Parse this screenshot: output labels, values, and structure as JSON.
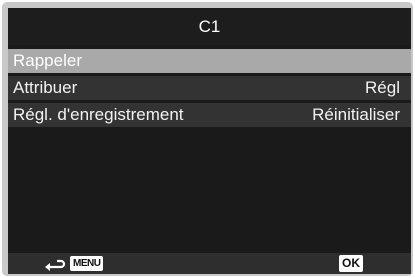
{
  "header": {
    "title": "C1"
  },
  "menu": {
    "items": [
      {
        "label": "Rappeler",
        "value": ""
      },
      {
        "label": "Attribuer",
        "value": "Régl"
      },
      {
        "label": "Régl. d'enregistrement",
        "value": "Réinitialiser"
      }
    ]
  },
  "footer": {
    "back_icon": "back-arrow-icon",
    "menu_label": "MENU",
    "ok_label": "OK"
  },
  "colors": {
    "selected_row": "#a9a9a9",
    "row": "#333333",
    "screen_bg": "#1a1a1a"
  }
}
